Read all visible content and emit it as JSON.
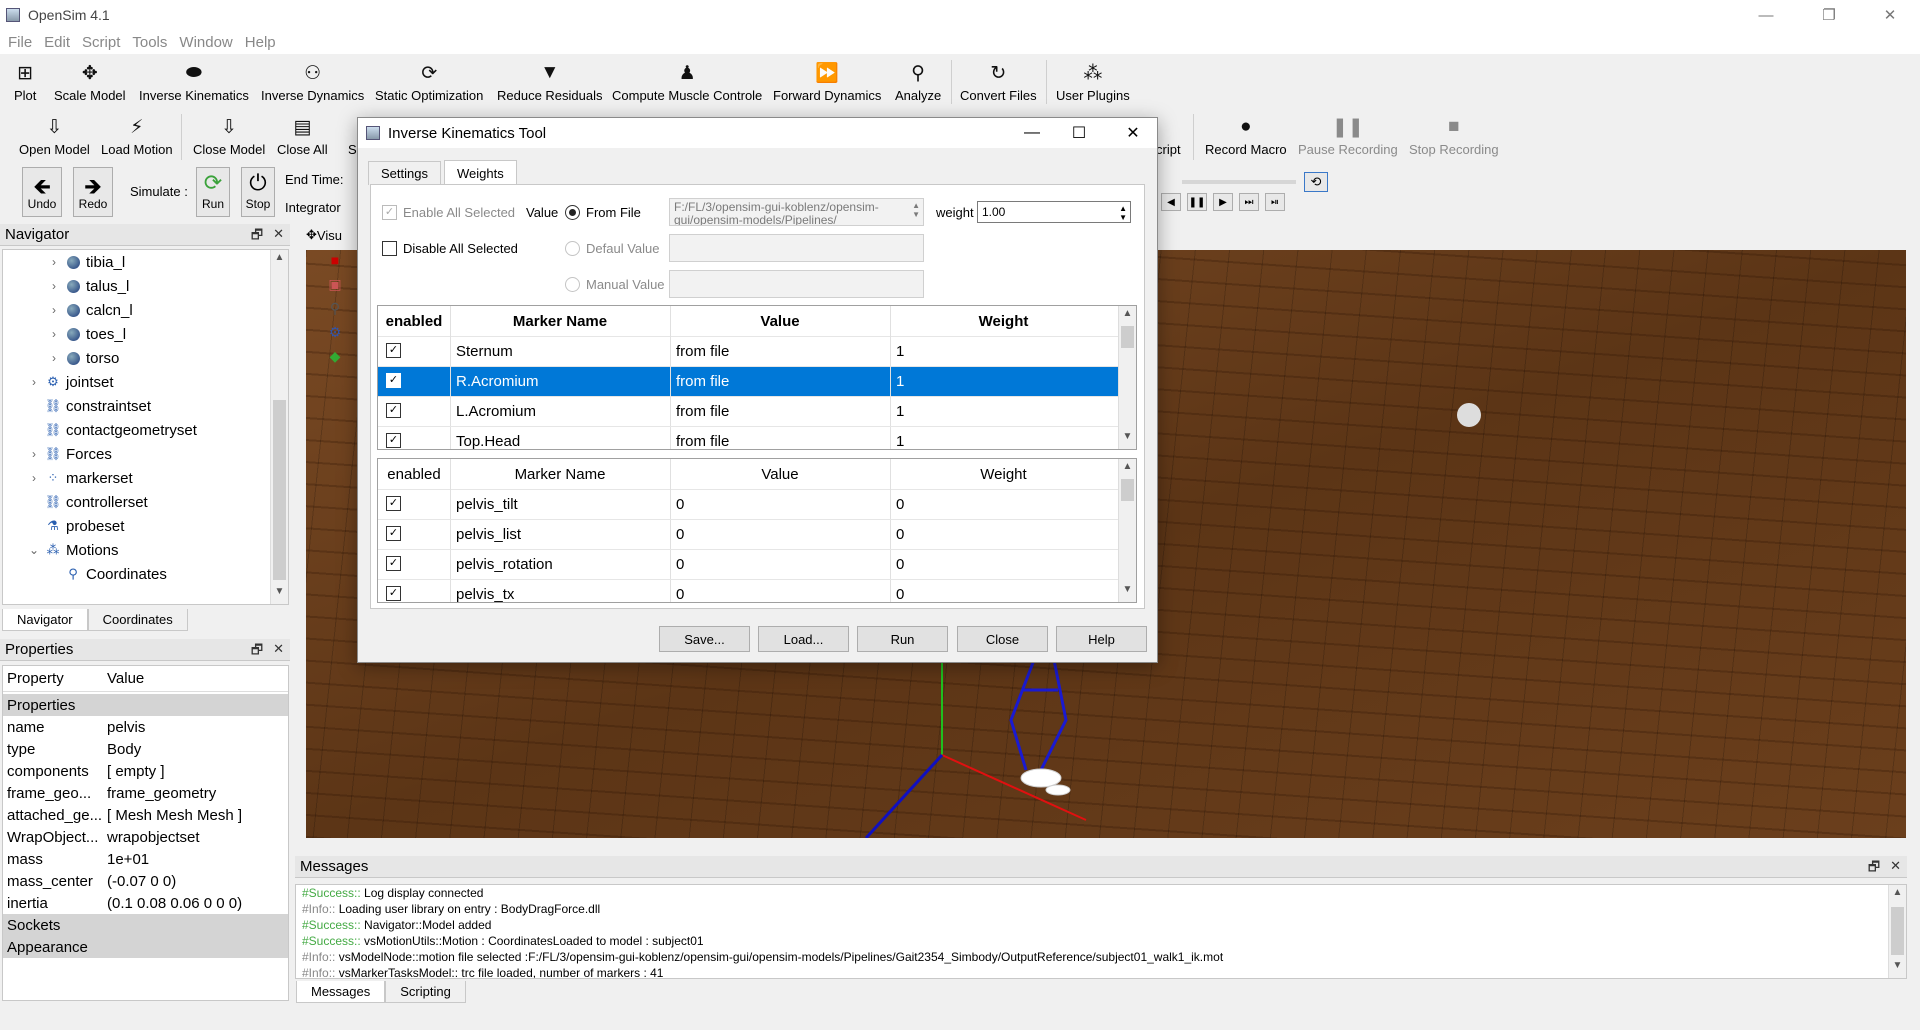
{
  "app": {
    "title": "OpenSim 4.1"
  },
  "window_controls": {
    "minimize": "—",
    "maximize": "❐",
    "close": "✕"
  },
  "menu": [
    "File",
    "Edit",
    "Script",
    "Tools",
    "Window",
    "Help"
  ],
  "toolbar1": [
    {
      "label": "Plot",
      "icon": "plot-icon",
      "glyph": "⊞"
    },
    {
      "label": "Scale Model",
      "icon": "scale-icon",
      "glyph": "✥"
    },
    {
      "label": "Inverse Kinematics",
      "icon": "ik-icon",
      "glyph": "⬬"
    },
    {
      "label": "Inverse Dynamics",
      "icon": "id-icon",
      "glyph": "⚇"
    },
    {
      "label": "Static Optimization",
      "icon": "so-icon",
      "glyph": "⟳"
    },
    {
      "label": "Reduce Residuals",
      "icon": "rra-icon",
      "glyph": "▼"
    },
    {
      "label": "Compute Muscle Controle",
      "icon": "cmc-icon",
      "glyph": "♟"
    },
    {
      "label": "Forward Dynamics",
      "icon": "fd-icon",
      "glyph": "⏩"
    },
    {
      "label": "Analyze",
      "icon": "analyze-icon",
      "glyph": "⚲"
    },
    {
      "label": "Convert Files",
      "icon": "convert-icon",
      "glyph": "↻"
    },
    {
      "label": "User Plugins",
      "icon": "plugins-icon",
      "glyph": "⁂"
    }
  ],
  "toolbar2": {
    "file_buttons": [
      {
        "label": "Open Model",
        "icon": "open-model-icon",
        "glyph": "⇩"
      },
      {
        "label": "Load Motion",
        "icon": "load-motion-icon",
        "glyph": "⚡"
      },
      {
        "label": "Close Model",
        "icon": "close-model-icon",
        "glyph": "⇩"
      },
      {
        "label": "Close All",
        "icon": "close-all-icon",
        "glyph": "▤"
      },
      {
        "label": "S",
        "icon": "save-icon",
        "glyph": ""
      }
    ],
    "script_label": "cript",
    "record_macro": "Record Macro",
    "pause_recording": "Pause Recording",
    "stop_recording": "Stop Recording"
  },
  "toolbar3": {
    "undo": "Undo",
    "redo": "Redo",
    "simulate": "Simulate :",
    "run": "Run",
    "stop": "Stop",
    "end_time": "End Time:",
    "integrator": "Integrator"
  },
  "navigator": {
    "title": "Navigator",
    "items": [
      {
        "label": "tibia_l",
        "icon": "body-icon"
      },
      {
        "label": "talus_l",
        "icon": "body-icon"
      },
      {
        "label": "calcn_l",
        "icon": "body-icon"
      },
      {
        "label": "toes_l",
        "icon": "body-icon"
      },
      {
        "label": "torso",
        "icon": "body-icon"
      },
      {
        "label": "jointset",
        "icon": "jointset-icon"
      },
      {
        "label": "constraintset",
        "icon": "constraintset-icon"
      },
      {
        "label": "contactgeometryset",
        "icon": "contactgeometry-icon"
      },
      {
        "label": "Forces",
        "icon": "forces-icon"
      },
      {
        "label": "markerset",
        "icon": "markerset-icon"
      },
      {
        "label": "controllerset",
        "icon": "controllerset-icon"
      },
      {
        "label": "probeset",
        "icon": "probeset-icon"
      },
      {
        "label": "Motions",
        "icon": "motions-icon"
      },
      {
        "label": "Coordinates",
        "icon": "coordinates-icon"
      }
    ],
    "tabs": [
      "Navigator",
      "Coordinates"
    ]
  },
  "properties": {
    "title": "Properties",
    "col_property": "Property",
    "col_value": "Value",
    "rows": [
      {
        "key": "Properties",
        "value": "",
        "category": true
      },
      {
        "key": "name",
        "value": "pelvis"
      },
      {
        "key": "type",
        "value": "Body"
      },
      {
        "key": "components",
        "value": "[  empty ]"
      },
      {
        "key": "frame_geo...",
        "value": "frame_geometry"
      },
      {
        "key": "attached_ge...",
        "value": "[ Mesh Mesh Mesh ]"
      },
      {
        "key": "WrapObject...",
        "value": "wrapobjectset"
      },
      {
        "key": "mass",
        "value": "1e+01"
      },
      {
        "key": "mass_center",
        "value": "(-0.07 0 0)"
      },
      {
        "key": "inertia",
        "value": "(0.1 0.08 0.06 0 0 0)"
      },
      {
        "key": "Sockets",
        "value": "",
        "category": true
      },
      {
        "key": "Appearance",
        "value": "",
        "category": true
      }
    ]
  },
  "viewer": {
    "tab_label": "Visu"
  },
  "messages": {
    "title": "Messages",
    "lines": [
      {
        "prefix": "#Success::",
        "kind": "success",
        "text": " Log display connected"
      },
      {
        "prefix": "#Info::",
        "kind": "info",
        "text": " Loading user library on entry : BodyDragForce.dll"
      },
      {
        "prefix": "#Success::",
        "kind": "success",
        "text": " Navigator::Model added"
      },
      {
        "prefix": "#Success::",
        "kind": "success",
        "text": " vsMotionUtils::Motion : CoordinatesLoaded to model : subject01"
      },
      {
        "prefix": "#Info::",
        "kind": "info",
        "text": " vsModelNode::motion file selected :F:/FL/3/opensim-gui-koblenz/opensim-gui/opensim-models/Pipelines/Gait2354_Simbody/OutputReference/subject01_walk1_ik.mot"
      },
      {
        "prefix": "#Info::",
        "kind": "info",
        "text": " vsMarkerTasksModel:: trc file loaded, number of markers : 41"
      }
    ],
    "tabs": [
      "Messages",
      "Scripting"
    ]
  },
  "dialog": {
    "title": "Inverse Kinematics Tool",
    "tabs": [
      "Settings",
      "Weights"
    ],
    "enable_all_selected": "Enable All Selected",
    "disable_all_selected": "Disable All Selected",
    "value_label": "Value",
    "from_file": "From File",
    "default_value": "Defaul Value",
    "manual_value": "Manual Value",
    "file_path": "F:/FL/3/opensim-gui-koblenz/opensim-gui/opensim-models/Pipelines/",
    "weight_label": "weight",
    "weight_value": "1.00",
    "marker_table": {
      "headers": [
        "enabled",
        "Marker Name",
        "Value",
        "Weight"
      ],
      "rows": [
        {
          "enabled": true,
          "name": "Sternum",
          "value": "from file",
          "weight": "1",
          "selected": false
        },
        {
          "enabled": true,
          "name": "R.Acromium",
          "value": "from file",
          "weight": "1",
          "selected": true
        },
        {
          "enabled": true,
          "name": "L.Acromium",
          "value": "from file",
          "weight": "1",
          "selected": false
        },
        {
          "enabled": true,
          "name": "Top.Head",
          "value": "from file",
          "weight": "1",
          "selected": false
        }
      ]
    },
    "coord_table": {
      "headers": [
        "enabled",
        "Marker Name",
        "Value",
        "Weight"
      ],
      "rows": [
        {
          "enabled": true,
          "name": "pelvis_tilt",
          "value": "0",
          "weight": "0"
        },
        {
          "enabled": true,
          "name": "pelvis_list",
          "value": "0",
          "weight": "0"
        },
        {
          "enabled": true,
          "name": "pelvis_rotation",
          "value": "0",
          "weight": "0"
        },
        {
          "enabled": true,
          "name": "pelvis_tx",
          "value": "0",
          "weight": "0"
        }
      ]
    },
    "buttons": [
      "Save...",
      "Load...",
      "Run",
      "Close",
      "Help"
    ]
  }
}
